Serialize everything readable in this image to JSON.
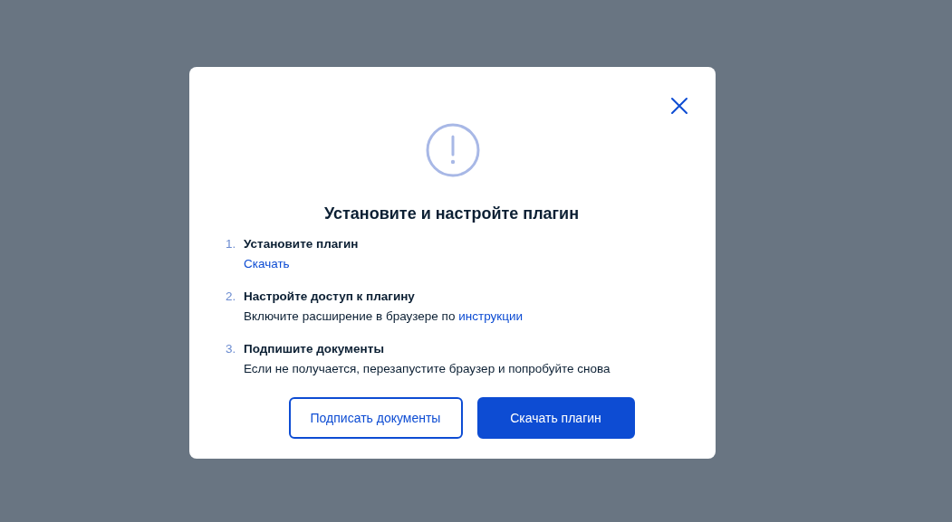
{
  "dialog": {
    "title": "Установите и настройте плагин",
    "steps": [
      {
        "number": "1.",
        "title": "Установите плагин",
        "link": "Скачать"
      },
      {
        "number": "2.",
        "title": "Настройте доступ к плагину",
        "detail": "Включите расширение в браузере по",
        "link": "инструкции"
      },
      {
        "number": "3.",
        "title": "Подпишите документы",
        "detail": "Если не получается, перезапустите браузер и попробуйте снова"
      }
    ],
    "buttons": [
      {
        "label": "Подписать документы",
        "kind": "secondary"
      },
      {
        "label": "Скачать плагин",
        "kind": "primary"
      }
    ]
  }
}
